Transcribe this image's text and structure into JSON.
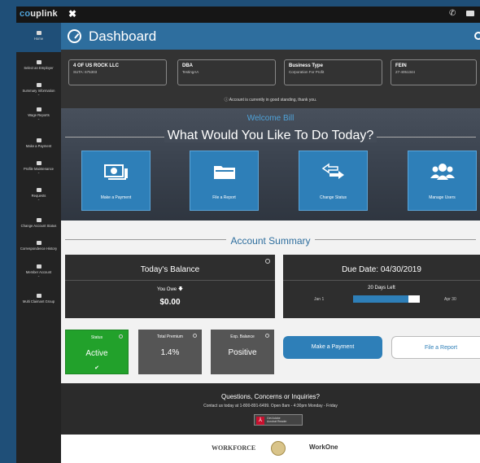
{
  "topbar": {
    "logo_prefix": "co",
    "logo_rest": "uplink"
  },
  "sidebar": {
    "items": [
      {
        "label": "Home",
        "chevron": ""
      },
      {
        "label": "Select an Employer",
        "chevron": ""
      },
      {
        "label": "Summary Information",
        "chevron": "⌄"
      },
      {
        "label": "Wage Reports",
        "chevron": "⌄"
      },
      {
        "label": "Make a Payment",
        "chevron": ""
      },
      {
        "label": "Profile Maintenance",
        "chevron": "⌄"
      },
      {
        "label": "Requests",
        "chevron": "⌄"
      },
      {
        "label": "Change Account Status",
        "chevron": ""
      },
      {
        "label": "Correspondence History",
        "chevron": ""
      },
      {
        "label": "Member Account",
        "chevron": "⌄"
      },
      {
        "label": "Multi Claimant Group",
        "chevron": ""
      }
    ]
  },
  "header": {
    "title": "Dashboard"
  },
  "info": {
    "boxes": [
      {
        "title": "4 OF US ROCK LLC",
        "value": "SUTA: 675303"
      },
      {
        "title": "DBA",
        "value": "TestingAA"
      },
      {
        "title": "Business Type",
        "value": "Corporation For Profit"
      },
      {
        "title": "FEIN",
        "value": "27-4051344"
      }
    ],
    "standing": "Account is currently in good standing, thank you."
  },
  "hero": {
    "welcome": "Welcome Bill",
    "question": "What Would You Like To Do Today?",
    "tiles": [
      {
        "label": "Make a Payment",
        "icon": "money-icon"
      },
      {
        "label": "File a Report",
        "icon": "folder-icon"
      },
      {
        "label": "Change Status",
        "icon": "exchange-icon"
      },
      {
        "label": "Manage Users",
        "icon": "users-icon"
      }
    ]
  },
  "summary": {
    "title": "Account Summary",
    "balance": {
      "title": "Today's Balance",
      "owe_label": "You Owe",
      "amount": "$0.00"
    },
    "due": {
      "title": "Due Date: 04/30/2019",
      "days_left": "20 Days Left",
      "start": "Jan 1",
      "end": "Apr 30",
      "progress": 0.83
    },
    "stats": [
      {
        "title": "Status",
        "value": "Active"
      },
      {
        "title": "Total Premium",
        "value": "1.4%"
      },
      {
        "title": "Exp. Balance",
        "value": "Positive"
      }
    ],
    "status_check": "✔",
    "pay_button": "Make a Payment",
    "file_button": "File a Report"
  },
  "footer": {
    "question": "Questions, Concerns or Inquiries?",
    "contact": "Contact us today at 1-800-891-6499. Open 8am - 4:30pm Monday - Friday",
    "adobe_line1": "Get Adobe",
    "adobe_line2": "Acrobat Reader"
  },
  "logos": {
    "workforce": "WORKFORCE",
    "workone": "WorkOne"
  },
  "colors": {
    "accent": "#2e7fb8",
    "header": "#2e6e9e",
    "active": "#22a12b",
    "sidebar": "#232323"
  }
}
